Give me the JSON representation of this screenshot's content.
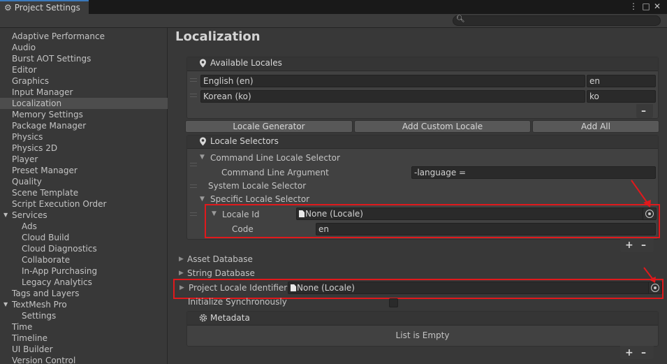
{
  "window": {
    "title": "Project Settings",
    "title_icon": "gear-icon",
    "controls": [
      "⋮",
      "□",
      "✕"
    ]
  },
  "search": {
    "placeholder": ""
  },
  "sidebar": {
    "items": [
      {
        "label": "Adaptive Performance"
      },
      {
        "label": "Audio"
      },
      {
        "label": "Burst AOT Settings"
      },
      {
        "label": "Editor"
      },
      {
        "label": "Graphics"
      },
      {
        "label": "Input Manager"
      },
      {
        "label": "Localization",
        "selected": true
      },
      {
        "label": "Memory Settings"
      },
      {
        "label": "Package Manager"
      },
      {
        "label": "Physics"
      },
      {
        "label": "Physics 2D"
      },
      {
        "label": "Player"
      },
      {
        "label": "Preset Manager"
      },
      {
        "label": "Quality"
      },
      {
        "label": "Scene Template"
      },
      {
        "label": "Script Execution Order"
      },
      {
        "label": "Services",
        "expanded": true
      },
      {
        "label": "Ads",
        "child": true
      },
      {
        "label": "Cloud Build",
        "child": true
      },
      {
        "label": "Cloud Diagnostics",
        "child": true
      },
      {
        "label": "Collaborate",
        "child": true
      },
      {
        "label": "In-App Purchasing",
        "child": true
      },
      {
        "label": "Legacy Analytics",
        "child": true
      },
      {
        "label": "Tags and Layers"
      },
      {
        "label": "TextMesh Pro",
        "expanded": true
      },
      {
        "label": "Settings",
        "child": true
      },
      {
        "label": "Time"
      },
      {
        "label": "Timeline"
      },
      {
        "label": "UI Builder"
      },
      {
        "label": "Version Control"
      }
    ]
  },
  "main": {
    "title": "Localization",
    "available_locales": {
      "header": "Available Locales",
      "rows": [
        {
          "name": "English (en)",
          "code": "en"
        },
        {
          "name": "Korean (ko)",
          "code": "ko"
        }
      ],
      "remove_label": "–"
    },
    "buttons": {
      "locale_generator": "Locale Generator",
      "add_custom_locale": "Add Custom Locale",
      "add_all": "Add All"
    },
    "locale_selectors": {
      "header": "Locale Selectors",
      "command_line": {
        "title": "Command Line Locale Selector",
        "arg_label": "Command Line Argument",
        "arg_value": "-language ="
      },
      "system": {
        "title": "System Locale Selector"
      },
      "specific": {
        "title": "Specific Locale Selector",
        "locale_id_label": "Locale Id",
        "locale_id_value": "None (Locale)",
        "code_label": "Code",
        "code_value": "en"
      },
      "add_label": "+",
      "remove_label": "–"
    },
    "asset_database": "Asset Database",
    "string_database": "String Database",
    "project_locale_identifier": {
      "label": "Project Locale Identifier",
      "value": "None (Locale)"
    },
    "initialize_synchronously": {
      "label": "Initialize Synchronously",
      "checked": false
    },
    "metadata": {
      "header": "Metadata",
      "empty_text": "List is Empty",
      "add_label": "+",
      "remove_label": "–"
    }
  },
  "colors": {
    "highlight_red": "#e0191c",
    "tab_accent": "#3a79bb",
    "background": "#383838"
  }
}
